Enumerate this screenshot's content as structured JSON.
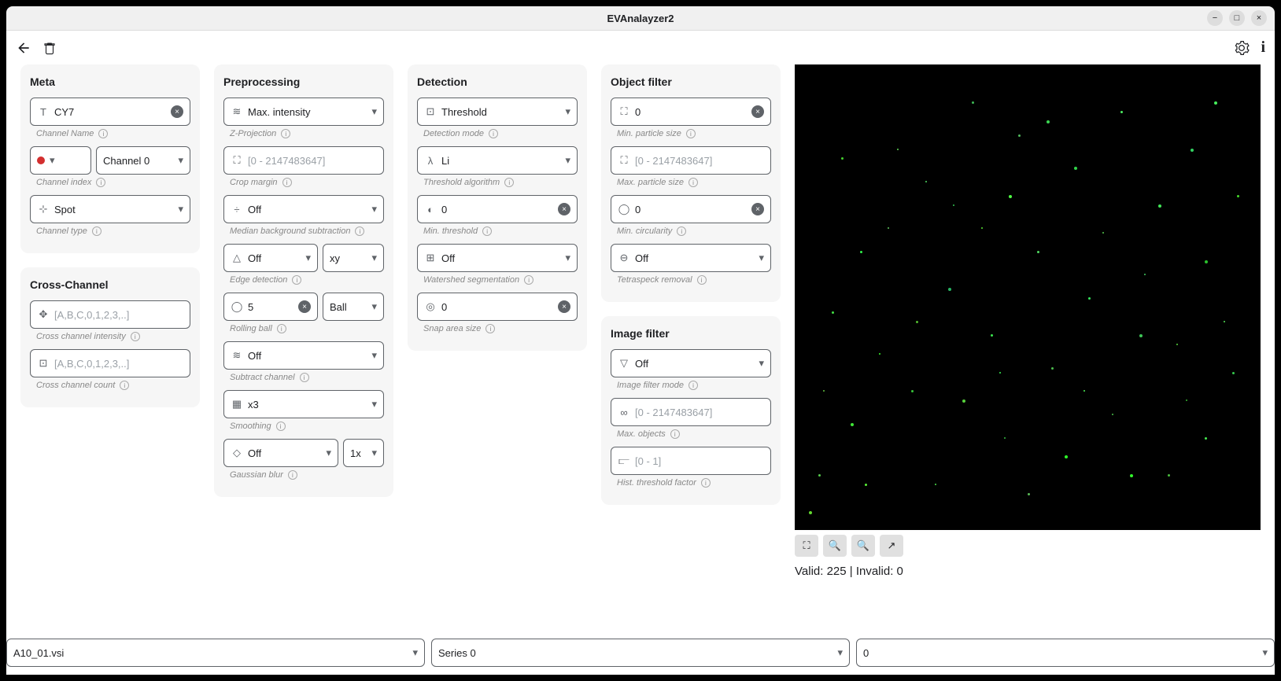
{
  "window": {
    "title": "EVAnalayzer2"
  },
  "panels": {
    "meta": {
      "title": "Meta",
      "channel_name": {
        "value": "CY7",
        "label": "Channel Name"
      },
      "channel_index": {
        "value": "Channel 0",
        "label": "Channel index"
      },
      "channel_type": {
        "value": "Spot",
        "label": "Channel type"
      }
    },
    "cross_channel": {
      "title": "Cross-Channel",
      "intensity": {
        "placeholder": "[A,B,C,0,1,2,3,..]",
        "label": "Cross channel intensity"
      },
      "count": {
        "placeholder": "[A,B,C,0,1,2,3,..]",
        "label": "Cross channel count"
      }
    },
    "preprocessing": {
      "title": "Preprocessing",
      "z_projection": {
        "value": "Max. intensity",
        "label": "Z-Projection"
      },
      "crop_margin": {
        "placeholder": "[0 - 2147483647]",
        "label": "Crop margin"
      },
      "median_bg": {
        "value": "Off",
        "label": "Median background subtraction"
      },
      "edge_detection": {
        "value": "Off",
        "axis": "xy",
        "label": "Edge detection"
      },
      "rolling_ball": {
        "value": "5",
        "type": "Ball",
        "label": "Rolling ball"
      },
      "subtract_channel": {
        "value": "Off",
        "label": "Subtract channel"
      },
      "smoothing": {
        "value": "x3",
        "label": "Smoothing"
      },
      "gaussian_blur": {
        "value": "Off",
        "mult": "1x",
        "label": "Gaussian blur"
      }
    },
    "detection": {
      "title": "Detection",
      "mode": {
        "value": "Threshold",
        "label": "Detection mode"
      },
      "threshold_algo": {
        "value": "Li",
        "label": "Threshold algorithm"
      },
      "min_threshold": {
        "value": "0",
        "label": "Min. threshold"
      },
      "watershed": {
        "value": "Off",
        "label": "Watershed segmentation"
      },
      "snap_area": {
        "value": "0",
        "label": "Snap area size"
      }
    },
    "object_filter": {
      "title": "Object filter",
      "min_particle": {
        "value": "0",
        "label": "Min. particle size"
      },
      "max_particle": {
        "placeholder": "[0 - 2147483647]",
        "label": "Max. particle size"
      },
      "min_circularity": {
        "value": "0",
        "label": "Min. circularity"
      },
      "tetraspeck": {
        "value": "Off",
        "label": "Tetraspeck removal"
      }
    },
    "image_filter": {
      "title": "Image filter",
      "mode": {
        "value": "Off",
        "label": "Image filter mode"
      },
      "max_objects": {
        "placeholder": "[0 - 2147483647]",
        "label": "Max. objects"
      },
      "hist_threshold": {
        "placeholder": "[0 - 1]",
        "label": "Hist. threshold factor"
      }
    }
  },
  "preview": {
    "status": "Valid: 225 | Invalid: 0"
  },
  "footer": {
    "file": "A10_01.vsi",
    "series": "Series 0",
    "index": "0"
  }
}
